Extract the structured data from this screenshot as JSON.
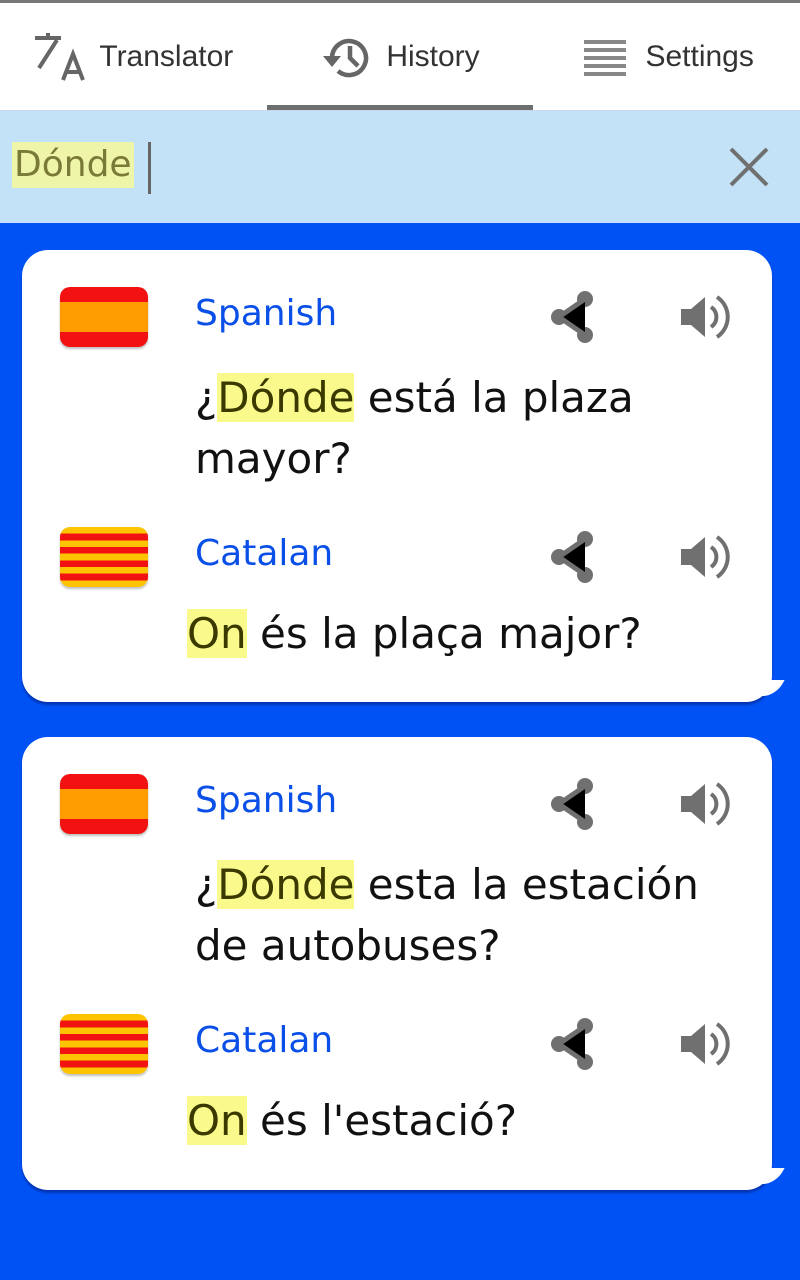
{
  "tabs": [
    {
      "label": "Translator",
      "icon": "translate-icon",
      "active": false
    },
    {
      "label": "History",
      "icon": "history-icon",
      "active": true
    },
    {
      "label": "Settings",
      "icon": "menu-icon",
      "active": false
    }
  ],
  "search": {
    "value": "Dónde",
    "clear_icon": "close-icon"
  },
  "colors": {
    "background": "#0052f5",
    "search_bar": "#c3e2f7",
    "language_label": "#0a50e8",
    "highlight": "#fafa8c"
  },
  "cards": [
    {
      "entries": [
        {
          "flag": "spain-flag",
          "language": "Spanish",
          "before": "¿",
          "highlight": "Dónde",
          "after": " está la plaza mayor?"
        },
        {
          "flag": "catalonia-flag",
          "language": "Catalan",
          "before": "",
          "highlight": "On",
          "after": " és la plaça major?"
        }
      ]
    },
    {
      "entries": [
        {
          "flag": "spain-flag",
          "language": "Spanish",
          "before": "¿",
          "highlight": "Dónde",
          "after": " esta la estación de autobuses?"
        },
        {
          "flag": "catalonia-flag",
          "language": "Catalan",
          "before": "",
          "highlight": "On",
          "after": " és l'estació?"
        }
      ]
    }
  ]
}
